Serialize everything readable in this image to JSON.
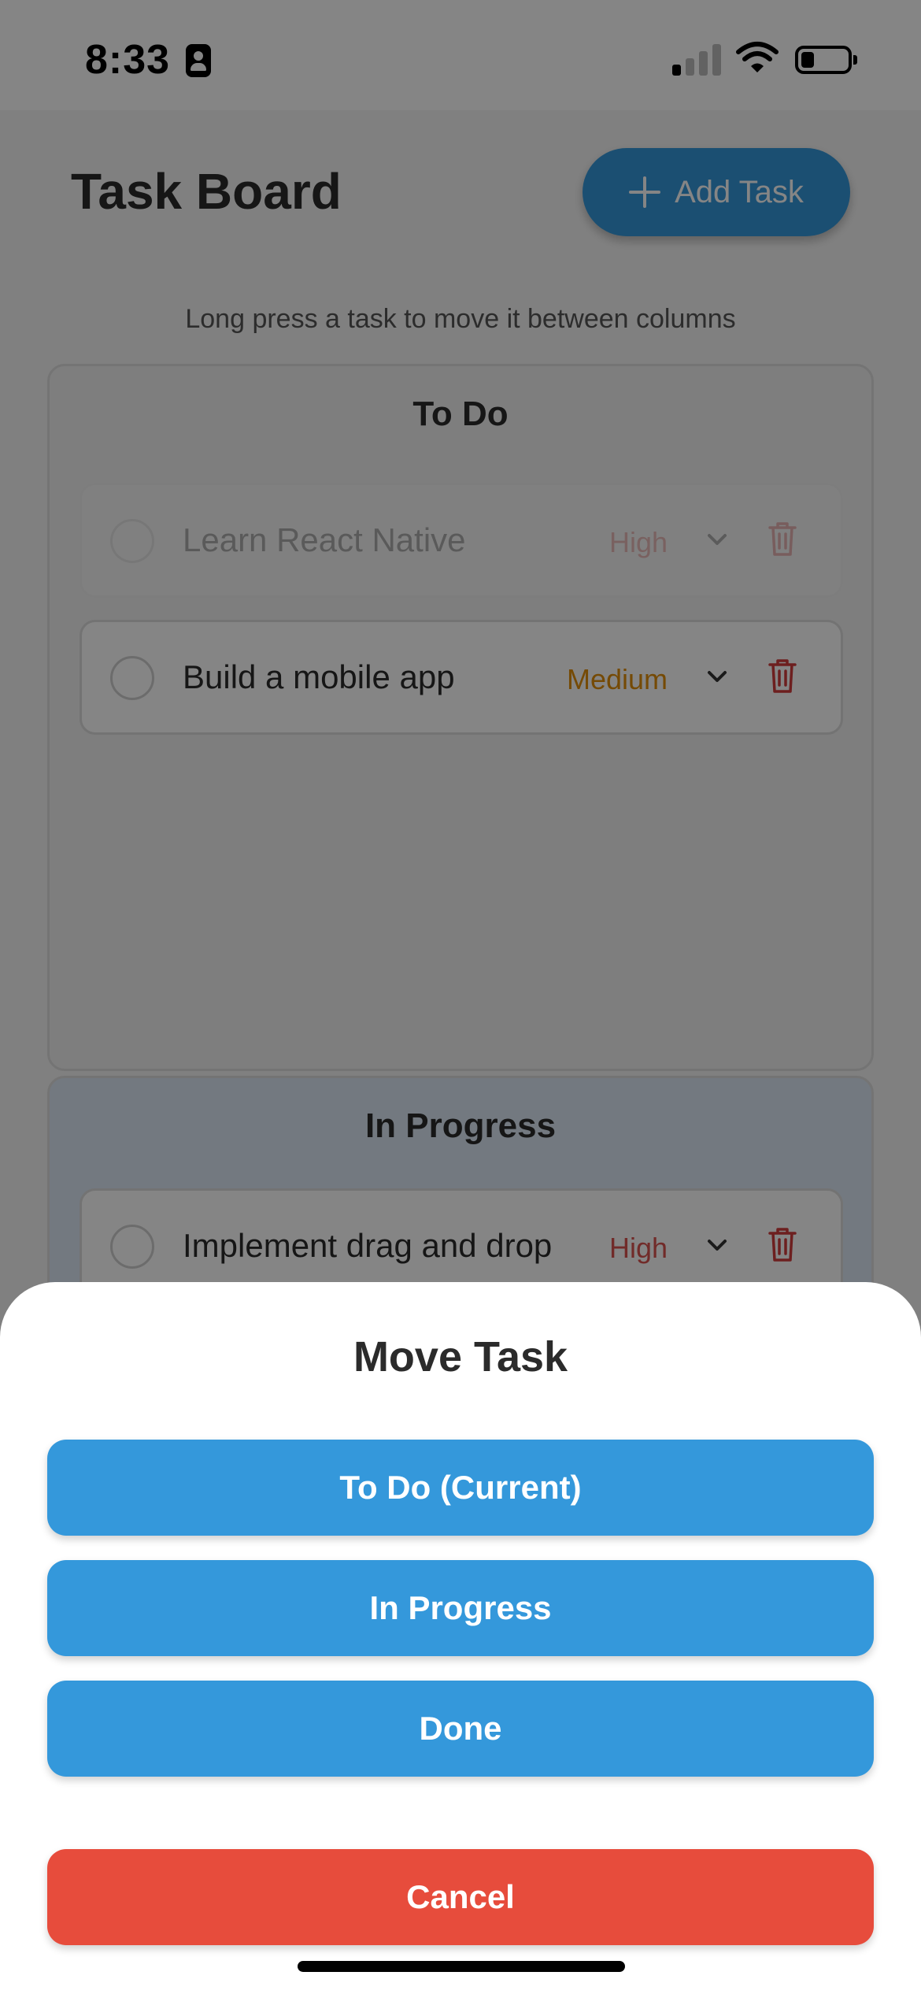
{
  "status_bar": {
    "time": "8:33",
    "icons": [
      "person-badge-icon",
      "cellular-signal-icon",
      "wifi-icon",
      "battery-icon"
    ]
  },
  "header": {
    "title": "Task Board",
    "add_button_label": "Add Task",
    "add_button_icon": "plus-icon"
  },
  "hint": "Long press a task to move it between columns",
  "columns": [
    {
      "title": "To Do",
      "tasks": [
        {
          "title": "Learn React Native",
          "priority": "High",
          "priority_color": "#d9534f",
          "dragging": true
        },
        {
          "title": "Build a mobile app",
          "priority": "Medium",
          "priority_color": "#e08e0b",
          "dragging": false
        }
      ]
    },
    {
      "title": "In Progress",
      "tasks": [
        {
          "title": "Implement drag and drop",
          "priority": "High",
          "priority_color": "#d9534f",
          "dragging": false
        }
      ]
    }
  ],
  "move_sheet": {
    "title": "Move Task",
    "options": [
      "To Do (Current)",
      "In Progress",
      "Done"
    ],
    "cancel_label": "Cancel"
  },
  "colors": {
    "accent": "#3498db",
    "danger": "#e74c3c",
    "trash": "#d23c3c"
  }
}
